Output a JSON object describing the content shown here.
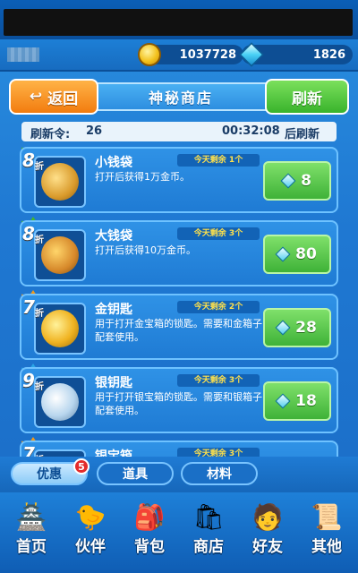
{
  "resources": {
    "gold": "1037728",
    "gems": "1826"
  },
  "header": {
    "back_label": "返回",
    "title": "神秘商店",
    "refresh_label": "刷新"
  },
  "refresh_info": {
    "label": "刷新令:",
    "count": "26",
    "timer": "00:32:08",
    "suffix": "后刷新"
  },
  "items": [
    {
      "discount": "8",
      "discount_unit": "折",
      "name": "小钱袋",
      "remain": "今天剩余 1个",
      "desc": "打开后获得1万金币。",
      "price": "8",
      "icon": "money-bag-icon"
    },
    {
      "discount": "8",
      "discount_unit": "折",
      "name": "大钱袋",
      "remain": "今天剩余 3个",
      "desc": "打开后获得10万金币。",
      "price": "80",
      "icon": "big-money-bag-icon"
    },
    {
      "discount": "7",
      "discount_unit": "折",
      "name": "金钥匙",
      "remain": "今天剩余 2个",
      "desc": "用于打开金宝箱的锁匙。需要和金箱子配套使用。",
      "price": "28",
      "icon": "gold-key-icon"
    },
    {
      "discount": "9",
      "discount_unit": "折",
      "name": "银钥匙",
      "remain": "今天剩余 3个",
      "desc": "用于打开银宝箱的锁匙。需要和银箱子配套使用。",
      "price": "18",
      "icon": "silver-key-icon"
    },
    {
      "discount": "7",
      "discount_unit": "折",
      "name": "银宝箱",
      "remain": "今天剩余 3个",
      "desc": "",
      "price": "",
      "icon": "silver-chest-icon"
    }
  ],
  "tabs": [
    {
      "label": "优惠",
      "badge": "5"
    },
    {
      "label": "道具"
    },
    {
      "label": "材料"
    }
  ],
  "nav": [
    {
      "label": "首页",
      "icon": "home-icon"
    },
    {
      "label": "伙伴",
      "icon": "partner-icon"
    },
    {
      "label": "背包",
      "icon": "bag-icon"
    },
    {
      "label": "商店",
      "icon": "shop-icon"
    },
    {
      "label": "好友",
      "icon": "friend-icon"
    },
    {
      "label": "其他",
      "icon": "other-icon"
    }
  ]
}
